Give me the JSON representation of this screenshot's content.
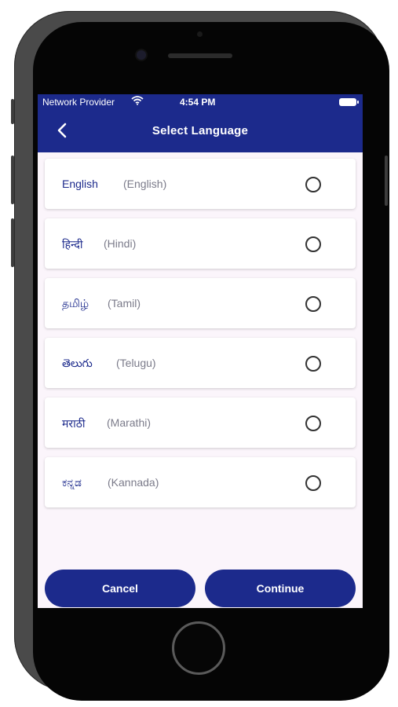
{
  "status_bar": {
    "carrier": "Network Provider",
    "time": "4:54 PM"
  },
  "header": {
    "title": "Select Language"
  },
  "languages": [
    {
      "native": "English",
      "english": "(English)"
    },
    {
      "native": "हिन्दी",
      "english": "(Hindi)"
    },
    {
      "native": "தமிழ்",
      "english": "(Tamil)"
    },
    {
      "native": "తెలుగు",
      "english": "(Telugu)"
    },
    {
      "native": "मराठी",
      "english": "(Marathi)"
    },
    {
      "native": "ಕನ್ನಡ",
      "english": "(Kannada)"
    }
  ],
  "actions": {
    "cancel": "Cancel",
    "continue": "Continue"
  },
  "colors": {
    "primary": "#1c2a8c",
    "background": "#fbf5fb"
  }
}
